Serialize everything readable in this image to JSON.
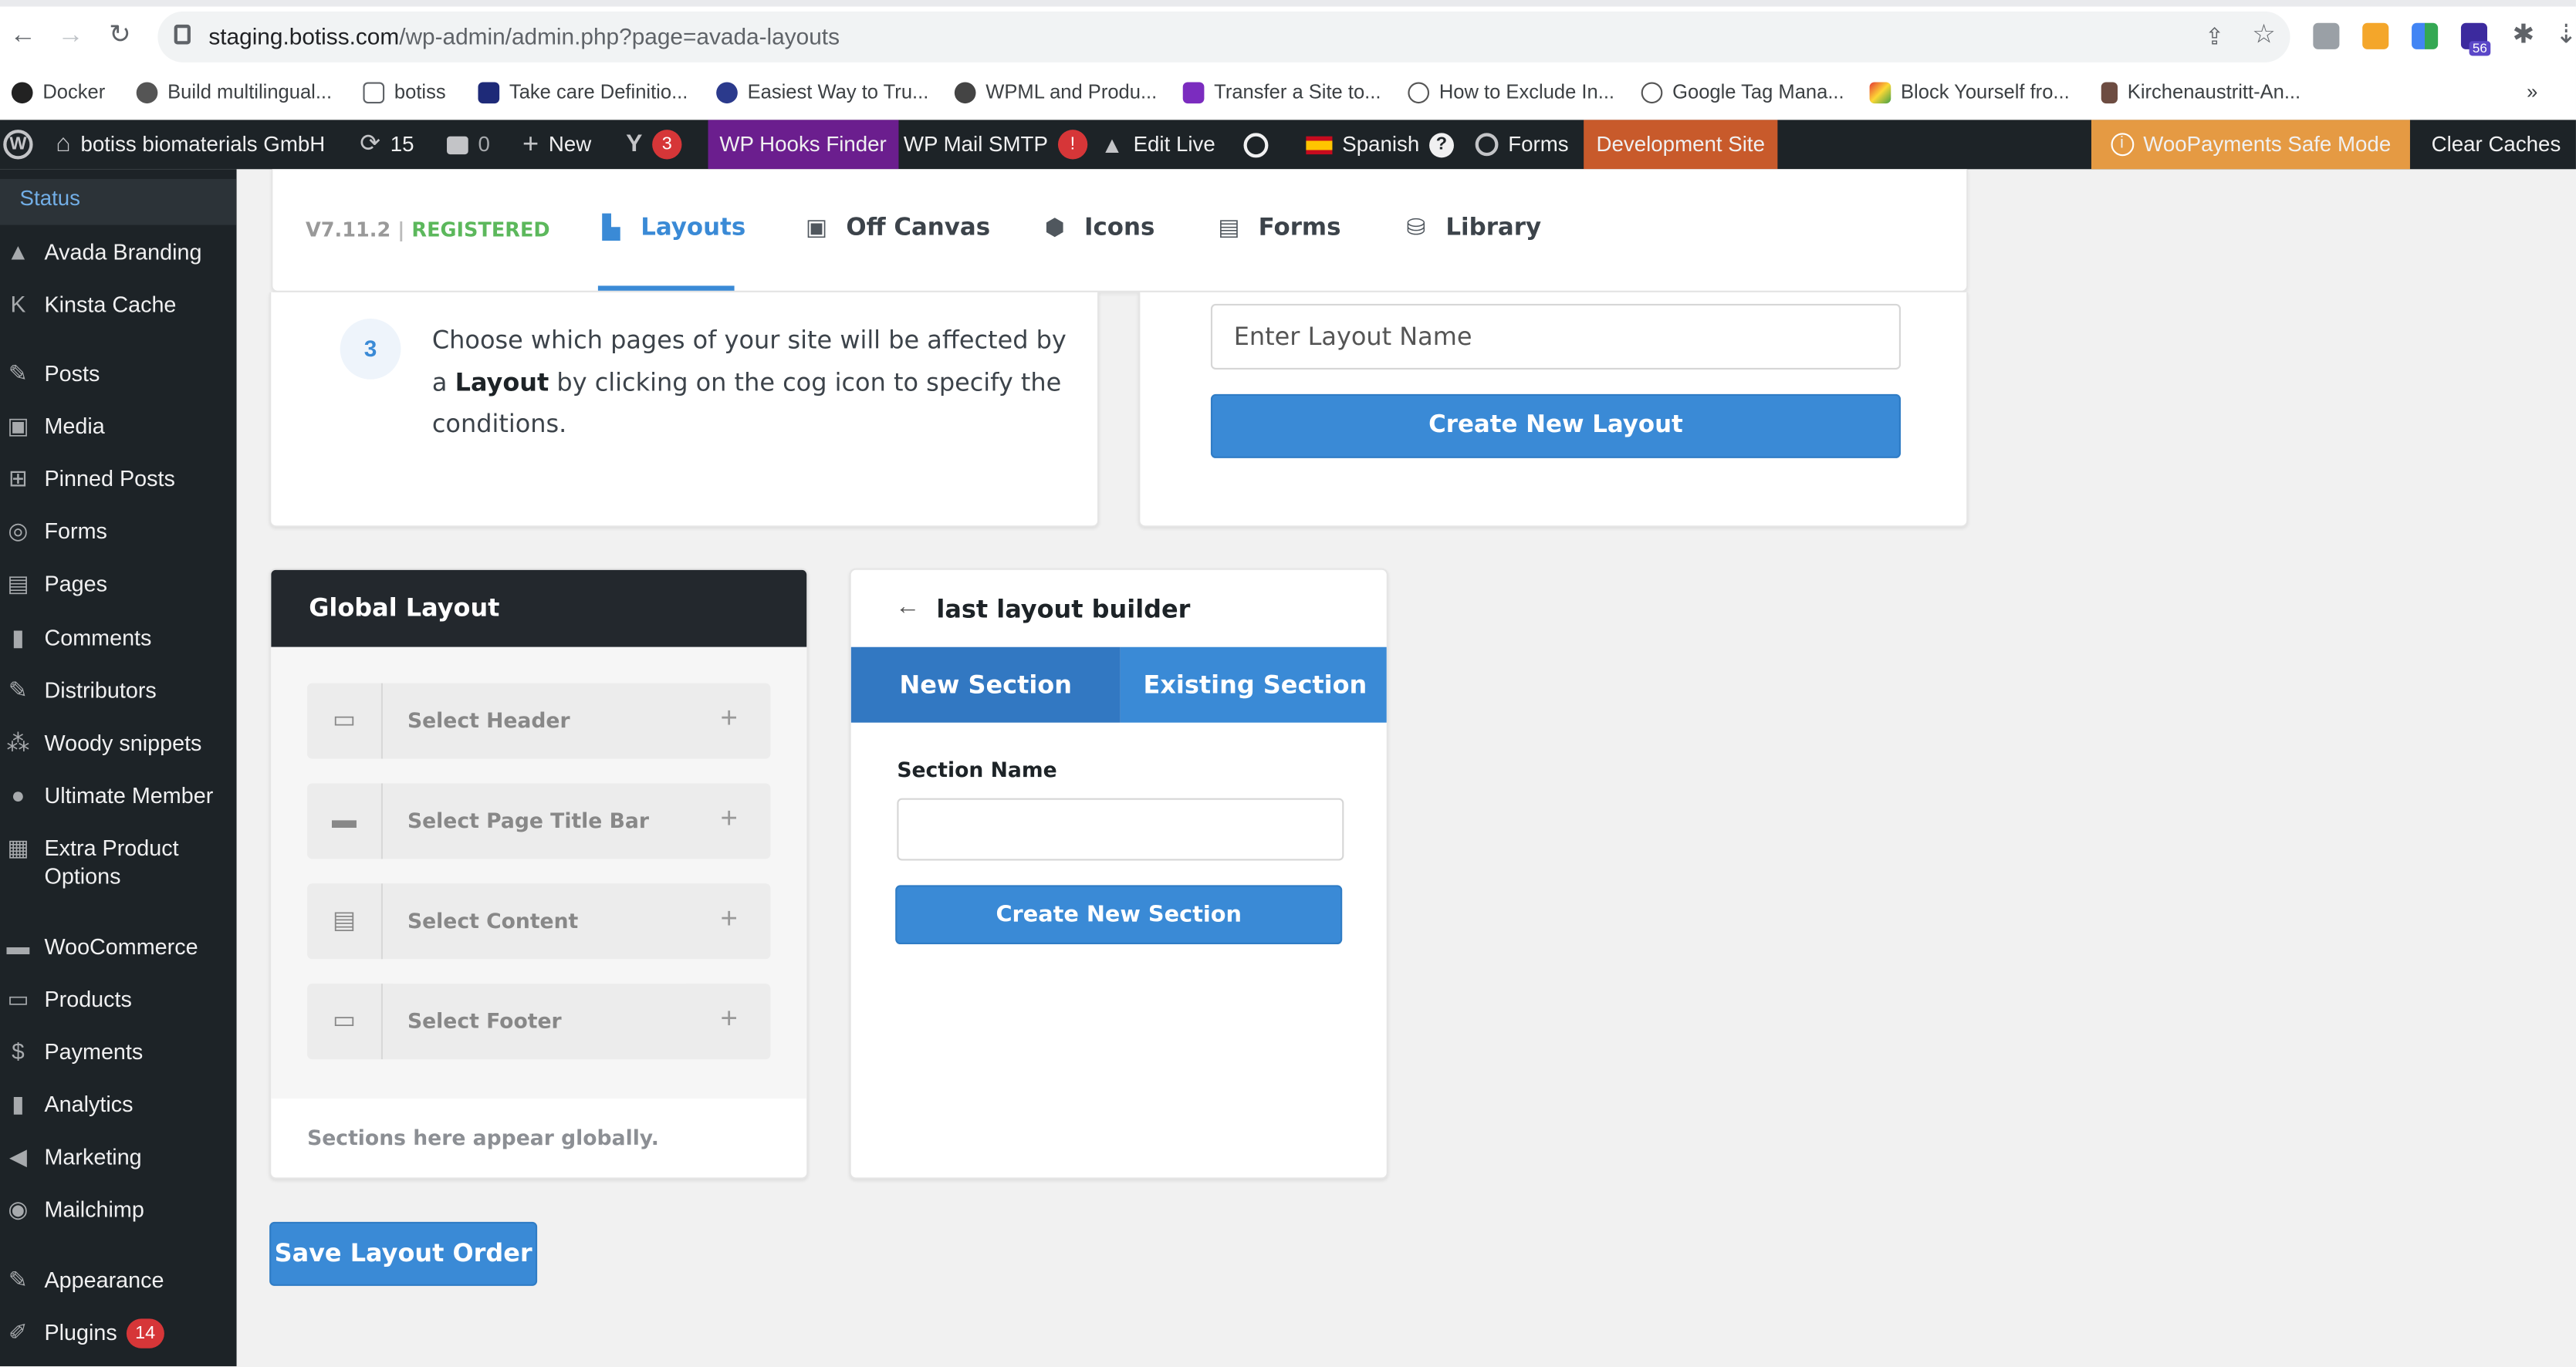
{
  "browser": {
    "url_host": "staging.botiss.com",
    "url_path": "/wp-admin/admin.php?page=avada-layouts",
    "bookmarks": [
      "Docker",
      "Build multilingual...",
      "botiss",
      "Take care Definitio...",
      "Easiest Way to Tru...",
      "WPML and Produ...",
      "Transfer a Site to...",
      "How to Exclude In...",
      "Google Tag Mana...",
      "Block Yourself fro...",
      "Kirchenaustritt-An..."
    ],
    "bookmarks_more": "»",
    "extension_badge": "56"
  },
  "adminbar": {
    "site_name": "botiss biomaterials GmbH",
    "updates_count": "15",
    "comments_count": "0",
    "new_label": "New",
    "yoast_count": "3",
    "hooks_finder": "WP Hooks Finder",
    "mail_smtp": "WP Mail SMTP",
    "mail_alert": "!",
    "edit_live": "Edit Live",
    "language": "Spanish",
    "forms": "Forms",
    "dev_site": "Development Site",
    "woopayments": "WooPayments Safe Mode",
    "clear_caches": "Clear Caches"
  },
  "sidebar": {
    "status": "Status",
    "items": [
      {
        "label": "Avada Branding",
        "icon": "avada-icon"
      },
      {
        "label": "Kinsta Cache",
        "icon": "kinsta-icon"
      },
      {
        "label": "Posts",
        "icon": "pin-icon"
      },
      {
        "label": "Media",
        "icon": "media-icon"
      },
      {
        "label": "Pinned Posts",
        "icon": "plus-square-icon"
      },
      {
        "label": "Forms",
        "icon": "forms-icon"
      },
      {
        "label": "Pages",
        "icon": "pages-icon"
      },
      {
        "label": "Comments",
        "icon": "comment-icon"
      },
      {
        "label": "Distributors",
        "icon": "pin-icon"
      },
      {
        "label": "Woody snippets",
        "icon": "snippets-icon"
      },
      {
        "label": "Ultimate Member",
        "icon": "user-icon"
      },
      {
        "label": "Extra Product",
        "label2": "Options",
        "icon": "grid-icon"
      },
      {
        "label": "WooCommerce",
        "icon": "woo-icon"
      },
      {
        "label": "Products",
        "icon": "archive-icon"
      },
      {
        "label": "Payments",
        "icon": "dollar-icon"
      },
      {
        "label": "Analytics",
        "icon": "bar-chart-icon"
      },
      {
        "label": "Marketing",
        "icon": "megaphone-icon"
      },
      {
        "label": "Mailchimp",
        "icon": "mailchimp-icon"
      },
      {
        "label": "Appearance",
        "icon": "brush-icon"
      },
      {
        "label": "Plugins",
        "icon": "plug-icon",
        "badge": "14"
      }
    ]
  },
  "avada_nav": {
    "version": "V7.11.2",
    "sep": "|",
    "registered": "REGISTERED",
    "tabs": [
      "Layouts",
      "Off Canvas",
      "Icons",
      "Forms",
      "Library"
    ]
  },
  "steps": {
    "number": "3",
    "text_a": "Choose which pages of your site will be affected by",
    "text_b_prefix": "a ",
    "text_b_bold": "Layout",
    "text_b_suffix": " by clicking on the cog icon to specify the",
    "text_c": "conditions."
  },
  "create_layout": {
    "placeholder": "Enter Layout Name",
    "button": "Create New Layout"
  },
  "global_layout": {
    "title": "Global Layout",
    "slots": [
      "Select Header",
      "Select Page Title Bar",
      "Select Content",
      "Select Footer"
    ],
    "footer_note": "Sections here appear globally."
  },
  "builder": {
    "title": "last layout builder",
    "tab_new": "New Section",
    "tab_existing": "Existing Section",
    "section_name_label": "Section Name",
    "section_name_value": "",
    "create_button": "Create New Section"
  },
  "save_button": "Save Layout Order",
  "colors": {
    "accent": "#3a8ad6",
    "admin_bar": "#1d2327",
    "registered_green": "#5cb85c",
    "dev_site": "#c85a2b",
    "woopayments": "#e59a43",
    "hooks_purple": "#6b1e8e"
  }
}
